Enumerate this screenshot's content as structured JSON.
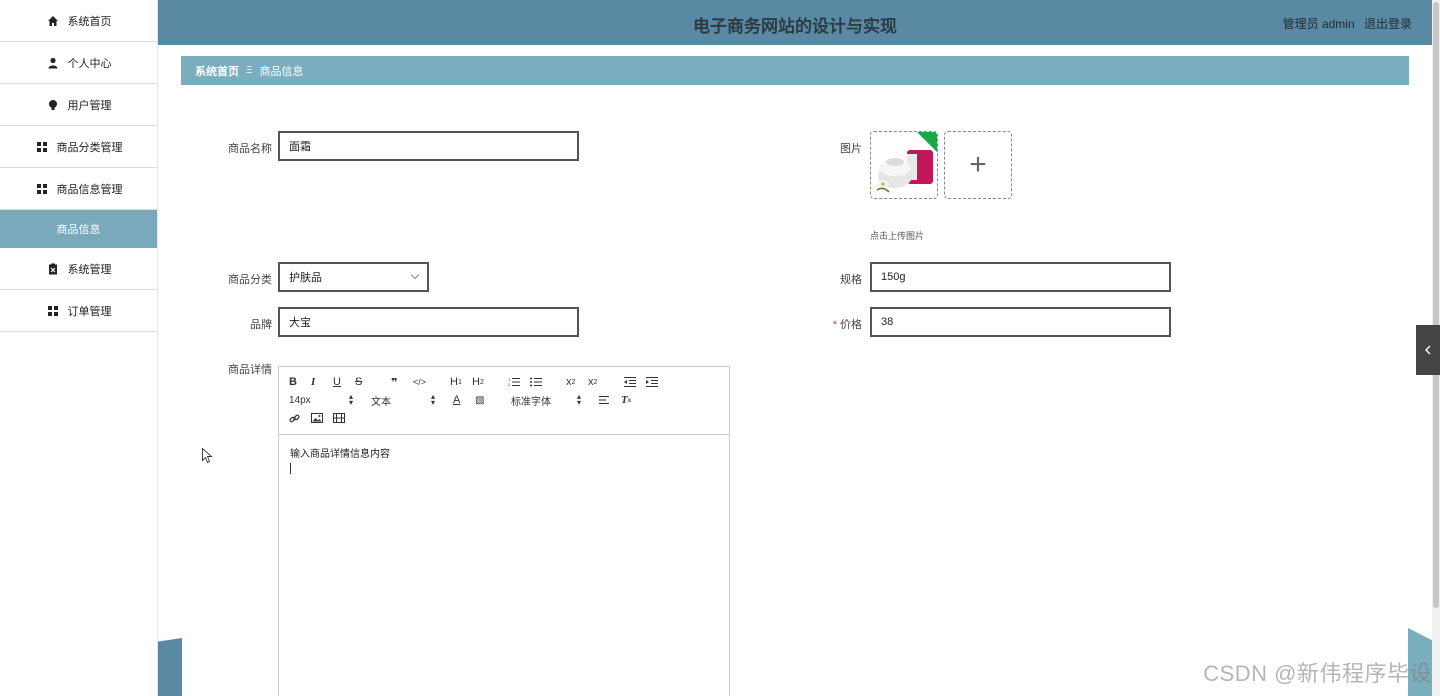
{
  "header": {
    "title": "电子商务网站的设计与实现",
    "user_role": "管理员 admin",
    "logout": "退出登录"
  },
  "sidebar": {
    "items": [
      {
        "label": "系统首页",
        "icon": "home-icon"
      },
      {
        "label": "个人中心",
        "icon": "person-icon"
      },
      {
        "label": "用户管理",
        "icon": "bulb-icon"
      },
      {
        "label": "商品分类管理",
        "icon": "grid-icon"
      },
      {
        "label": "商品信息管理",
        "icon": "grid-icon"
      },
      {
        "label": "商品信息",
        "icon": ""
      },
      {
        "label": "系统管理",
        "icon": "clipboard-icon"
      },
      {
        "label": "订单管理",
        "icon": "grid-icon"
      }
    ]
  },
  "breadcrumb": {
    "home": "系统首页",
    "separator": "Ξ",
    "current": "商品信息"
  },
  "form": {
    "name_label": "商品名称",
    "name_value": "面霜",
    "image_label": "图片",
    "image_hint": "点击上传图片",
    "category_label": "商品分类",
    "category_value": "护肤品",
    "spec_label": "规格",
    "spec_value": "150g",
    "brand_label": "品牌",
    "brand_value": "大宝",
    "price_required": "*",
    "price_label": "价格",
    "price_value": "38",
    "detail_label": "商品详情"
  },
  "editor": {
    "font_size": "14px",
    "format": "文本",
    "font_family": "标准字体",
    "content": "输入商品详情信息内容"
  },
  "watermark": "CSDN @新伟程序毕设",
  "colors": {
    "header_bg": "#5a8aa3",
    "breadcrumb_bg": "#7aaebe",
    "active_menu_bg": "#7aa9bb",
    "required": "#e0403a"
  }
}
